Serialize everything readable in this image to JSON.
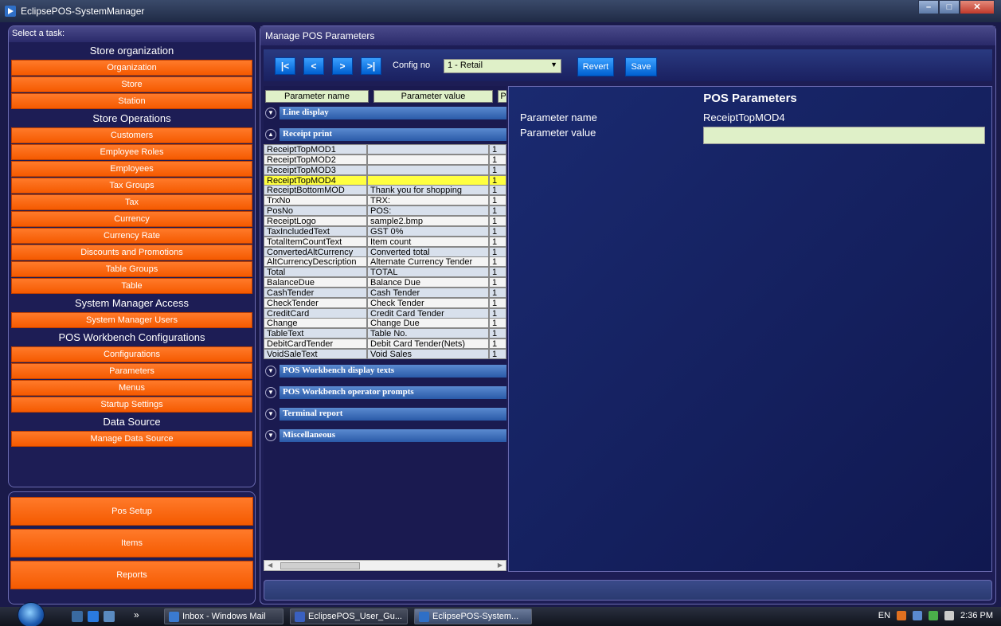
{
  "window": {
    "title": "EclipsePOS-SystemManager"
  },
  "sidebar": {
    "header": "Select a task:",
    "sections": [
      {
        "title": "Store organization",
        "items": [
          "Organization",
          "Store",
          "Station"
        ]
      },
      {
        "title": "Store Operations",
        "items": [
          "Customers",
          "Employee Roles",
          "Employees",
          "Tax Groups",
          "Tax",
          "Currency",
          "Currency Rate",
          "Discounts and Promotions",
          "Table Groups",
          "Table"
        ]
      },
      {
        "title": "System Manager Access",
        "items": [
          "System Manager Users"
        ]
      },
      {
        "title": "POS Workbench Configurations",
        "items": [
          "Configurations",
          "Parameters",
          "Menus",
          "Startup Settings"
        ]
      },
      {
        "title": "Data Source",
        "items": [
          "Manage Data Source"
        ]
      }
    ],
    "bottom_buttons": [
      "Pos Setup",
      "Items",
      "Reports"
    ]
  },
  "main": {
    "header": "Manage POS Parameters",
    "toolbar": {
      "first": "|<",
      "prev": "<",
      "next": ">",
      "last": ">|",
      "config_label": "Config no",
      "config_value": "1  -  Retail",
      "revert": "Revert",
      "save": "Save"
    },
    "grid": {
      "columns": [
        "Parameter name",
        "Parameter value",
        "P"
      ],
      "groups_before": [
        {
          "label": "Line display",
          "expanded": false
        },
        {
          "label": "Receipt print",
          "expanded": true
        }
      ],
      "rows": [
        {
          "name": "ReceiptTopMOD1",
          "value": "",
          "flag": "1"
        },
        {
          "name": "ReceiptTopMOD2",
          "value": "",
          "flag": "1"
        },
        {
          "name": "ReceiptTopMOD3",
          "value": "",
          "flag": "1"
        },
        {
          "name": "ReceiptTopMOD4",
          "value": "",
          "flag": "1",
          "selected": true
        },
        {
          "name": "ReceiptBottomMOD",
          "value": "Thank you for shopping",
          "flag": "1"
        },
        {
          "name": "TrxNo",
          "value": "TRX:",
          "flag": "1"
        },
        {
          "name": "PosNo",
          "value": "POS:",
          "flag": "1"
        },
        {
          "name": "ReceiptLogo",
          "value": "sample2.bmp",
          "flag": "1"
        },
        {
          "name": "TaxIncludedText",
          "value": "GST  0%",
          "flag": "1"
        },
        {
          "name": "TotalItemCountText",
          "value": "Item count",
          "flag": "1"
        },
        {
          "name": "ConvertedAltCurrency",
          "value": "Converted total",
          "flag": "1"
        },
        {
          "name": "AltCurrencyDescription",
          "value": "Alternate Currency Tender",
          "flag": "1"
        },
        {
          "name": "Total",
          "value": "TOTAL",
          "flag": "1"
        },
        {
          "name": "BalanceDue",
          "value": "Balance Due",
          "flag": "1"
        },
        {
          "name": "CashTender",
          "value": "Cash Tender",
          "flag": "1"
        },
        {
          "name": "CheckTender",
          "value": "Check Tender",
          "flag": "1"
        },
        {
          "name": "CreditCard",
          "value": "Credit Card Tender",
          "flag": "1"
        },
        {
          "name": "Change",
          "value": "Change Due",
          "flag": "1"
        },
        {
          "name": "TableText",
          "value": "Table No.",
          "flag": "1"
        },
        {
          "name": "DebitCardTender",
          "value": "Debit Card Tender(Nets)",
          "flag": "1"
        },
        {
          "name": "VoidSaleText",
          "value": "Void Sales",
          "flag": "1"
        }
      ],
      "groups_after": [
        {
          "label": "POS Workbench display texts",
          "expanded": false
        },
        {
          "label": "POS Workbench operator prompts",
          "expanded": false
        },
        {
          "label": "Terminal report",
          "expanded": false
        },
        {
          "label": "Miscellaneous",
          "expanded": false
        }
      ],
      "scrollbar_thumb": "III"
    },
    "detail": {
      "title": "POS Parameters",
      "name_label": "Parameter name",
      "name_value": "ReceiptTopMOD4",
      "value_label": "Parameter value",
      "value_value": ""
    }
  },
  "taskbar": {
    "items": [
      {
        "label": "Inbox - Windows Mail",
        "color": "#3a7ad0"
      },
      {
        "label": "EclipsePOS_User_Gu...",
        "color": "#3a60c0"
      },
      {
        "label": "EclipsePOS-System...",
        "color": "#2f6fc6",
        "active": true
      }
    ],
    "lang": "EN",
    "time": "2:36 PM"
  },
  "colors": {
    "accent_orange": "#f55a00",
    "selected_row": "#ffff40",
    "button_blue": "#0060d0"
  }
}
